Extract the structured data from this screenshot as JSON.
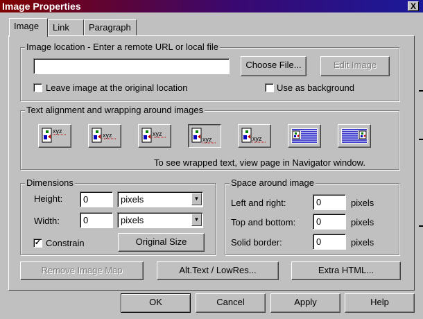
{
  "window": {
    "title": "Image Properties",
    "close_glyph": "X"
  },
  "tabs": [
    "Image",
    "Link",
    "Paragraph"
  ],
  "image_location": {
    "group_label": "Image location - Enter a remote URL or local file",
    "url_value": "",
    "choose_file_label": "Choose File...",
    "edit_image_label": "Edit Image",
    "leave_original_label": "Leave image at the original location",
    "leave_original_checked": false,
    "use_background_label": "Use as background",
    "use_background_checked": false
  },
  "alignment": {
    "group_label": "Text alignment and wrapping around images",
    "hint": "To see wrapped text, view page in Navigator window.",
    "options": [
      {
        "icon": "align-top-icon",
        "text": "xyz"
      },
      {
        "icon": "align-middle-icon",
        "text": "xyz"
      },
      {
        "icon": "align-center-icon",
        "text": "xyz"
      },
      {
        "icon": "align-bottom-icon",
        "text": "xyz"
      },
      {
        "icon": "align-baseline-icon",
        "text": "xyz"
      },
      {
        "icon": "wrap-left-icon",
        "text": ""
      },
      {
        "icon": "wrap-right-icon",
        "text": ""
      }
    ],
    "selected_index": 3
  },
  "dimensions": {
    "group_label": "Dimensions",
    "height_label": "Height:",
    "height_value": "0",
    "height_unit": "pixels",
    "width_label": "Width:",
    "width_value": "0",
    "width_unit": "pixels",
    "constrain_label": "Constrain",
    "constrain_checked": true,
    "original_size_label": "Original Size"
  },
  "space": {
    "group_label": "Space around image",
    "left_right_label": "Left and right:",
    "left_right_value": "0",
    "top_bottom_label": "Top and bottom:",
    "top_bottom_value": "0",
    "solid_border_label": "Solid border:",
    "solid_border_value": "0",
    "unit": "pixels"
  },
  "panel_buttons": {
    "remove_image_map": "Remove Image Map",
    "alt_text": "Alt.Text / LowRes...",
    "extra_html": "Extra HTML..."
  },
  "dialog_buttons": {
    "ok": "OK",
    "cancel": "Cancel",
    "apply": "Apply",
    "help": "Help"
  },
  "colors": {
    "face": "#c0c0c0",
    "title_start": "#800000",
    "title_end": "#1a1a9a",
    "icon_red": "#c00000",
    "icon_blue": "#0000c0",
    "icon_green": "#008000"
  }
}
